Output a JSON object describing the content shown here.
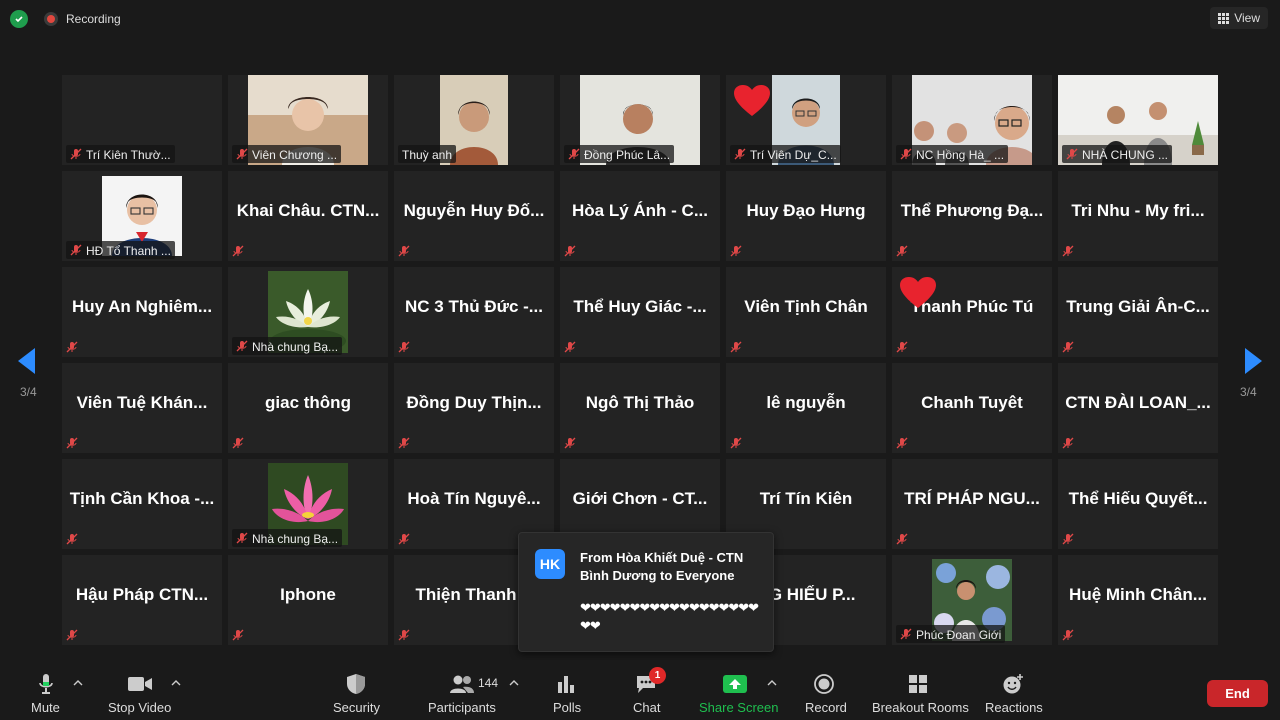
{
  "topbar": {
    "recording_label": "Recording",
    "view_label": "View"
  },
  "pager": {
    "left": "3/4",
    "right": "3/4"
  },
  "tiles": [
    {
      "name": "Trí Kiên Thườ...",
      "type": "label"
    },
    {
      "name": "Viên Chương ...",
      "type": "label",
      "photo": "woman-smiling"
    },
    {
      "name": "Thuỳ anh",
      "type": "label",
      "photo": "woman"
    },
    {
      "name": "Đồng Phúc Lâ...",
      "type": "label",
      "photo": "man"
    },
    {
      "name": "Trí Viên Dự_C...",
      "type": "label",
      "photo": "man-glasses"
    },
    {
      "name": "NC Hồng Hà_ ...",
      "type": "label",
      "photo": "group"
    },
    {
      "name": "NHÀ CHUNG ...",
      "type": "label",
      "photo": "group-room"
    },
    {
      "name": "HĐ Tổ Thanh ...",
      "type": "label",
      "photo": "woman-glasses"
    },
    {
      "name": "Khai Châu. CTN...",
      "type": "big"
    },
    {
      "name": "Nguyễn Huy Đố...",
      "type": "big"
    },
    {
      "name": "Hòa Lý Ánh - C...",
      "type": "big"
    },
    {
      "name": "Huy Đạo Hưng",
      "type": "big"
    },
    {
      "name": "Thể Phương Đạ...",
      "type": "big"
    },
    {
      "name": "Tri Nhu - My fri...",
      "type": "big"
    },
    {
      "name": "Huy An Nghiêm...",
      "type": "big"
    },
    {
      "name": "Nhà chung Bạ...",
      "type": "label",
      "photo": "lotus-white"
    },
    {
      "name": "NC 3 Thủ Đức -...",
      "type": "big"
    },
    {
      "name": "Thể Huy Giác -...",
      "type": "big"
    },
    {
      "name": "Viên Tịnh Chân",
      "type": "big"
    },
    {
      "name": "Thanh Phúc Tú",
      "type": "big"
    },
    {
      "name": "Trung Giải Ân-C...",
      "type": "big"
    },
    {
      "name": "Viên Tuệ  Khán...",
      "type": "big"
    },
    {
      "name": "giac thông",
      "type": "big"
    },
    {
      "name": "Đồng Duy Thịn...",
      "type": "big"
    },
    {
      "name": "Ngô Thị Thảo",
      "type": "big"
    },
    {
      "name": "lê nguyễn",
      "type": "big"
    },
    {
      "name": "Chanh Tuyêt",
      "type": "big"
    },
    {
      "name": "CTN ĐÀI LOAN_...",
      "type": "big"
    },
    {
      "name": "Tịnh Cần Khoa -...",
      "type": "big"
    },
    {
      "name": "Nhà chung Bạ...",
      "type": "label",
      "photo": "lotus-pink"
    },
    {
      "name": "Hoà Tín Nguyê...",
      "type": "big"
    },
    {
      "name": "Giới Chơn - CT...",
      "type": "big"
    },
    {
      "name": "Trí Tín Kiên",
      "type": "big"
    },
    {
      "name": "TRÍ PHÁP NGU...",
      "type": "big"
    },
    {
      "name": "Thể Hiếu Quyết...",
      "type": "big"
    },
    {
      "name": "Hậu Pháp CTN...",
      "type": "big"
    },
    {
      "name": "Iphone",
      "type": "big"
    },
    {
      "name": "Thiện Thanh P",
      "type": "big"
    },
    {
      "name": "",
      "type": "big"
    },
    {
      "name": "NG HIẾU P...",
      "type": "big"
    },
    {
      "name": "Phúc Đoan Giới",
      "type": "label",
      "photo": "woman-flowers"
    },
    {
      "name": "Huệ Minh Chân...",
      "type": "big"
    }
  ],
  "chat": {
    "avatar_initials": "HK",
    "from": "From Hòa Khiết Duệ - CTN Bình Dương to Everyone",
    "message": "❤❤❤❤❤❤❤❤❤❤❤❤❤❤❤❤❤❤❤❤"
  },
  "toolbar": {
    "mute": "Mute",
    "stop_video": "Stop Video",
    "security": "Security",
    "participants": "Participants",
    "participants_count": "144",
    "polls": "Polls",
    "chat": "Chat",
    "chat_badge": "1",
    "share_screen": "Share Screen",
    "record": "Record",
    "breakout_rooms": "Breakout Rooms",
    "reactions": "Reactions",
    "end": "End"
  },
  "colors": {
    "share_green": "#1fbf4f",
    "end_red": "#c9262a",
    "accent_blue": "#2d8cff"
  }
}
